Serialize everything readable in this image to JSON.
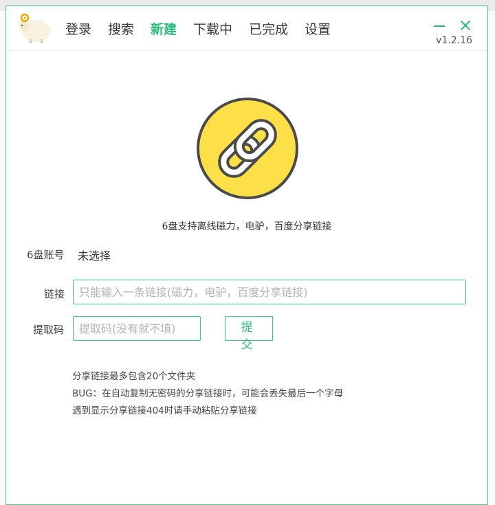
{
  "nav": {
    "items": [
      {
        "label": "登录"
      },
      {
        "label": "搜索"
      },
      {
        "label": "新建"
      },
      {
        "label": "下载中"
      },
      {
        "label": "已完成"
      },
      {
        "label": "设置"
      }
    ],
    "active_index": 2
  },
  "version": "v1.2.16",
  "hero": {
    "icon": "link-icon",
    "tagline": "6盘支持离线磁力，电驴，百度分享链接"
  },
  "form": {
    "account_label": "6盘账号",
    "account_value": "未选择",
    "link_label": "链接",
    "link_value": "",
    "link_placeholder": "只能输入一条链接(磁力，电驴，百度分享链接)",
    "code_label": "提取码",
    "code_value": "",
    "code_placeholder": "提取码(没有就不填)",
    "submit_label": "提 交"
  },
  "notes": [
    "分享链接最多包含20个文件夹",
    "BUG：在自动复制无密码的分享链接时，可能会丢失最后一个字母",
    "遇到显示分享链接404时请手动粘贴分享链接"
  ],
  "colors": {
    "accent": "#2dbb7c",
    "hero_fill": "#fde047",
    "hero_stroke": "#4a4a4a"
  }
}
